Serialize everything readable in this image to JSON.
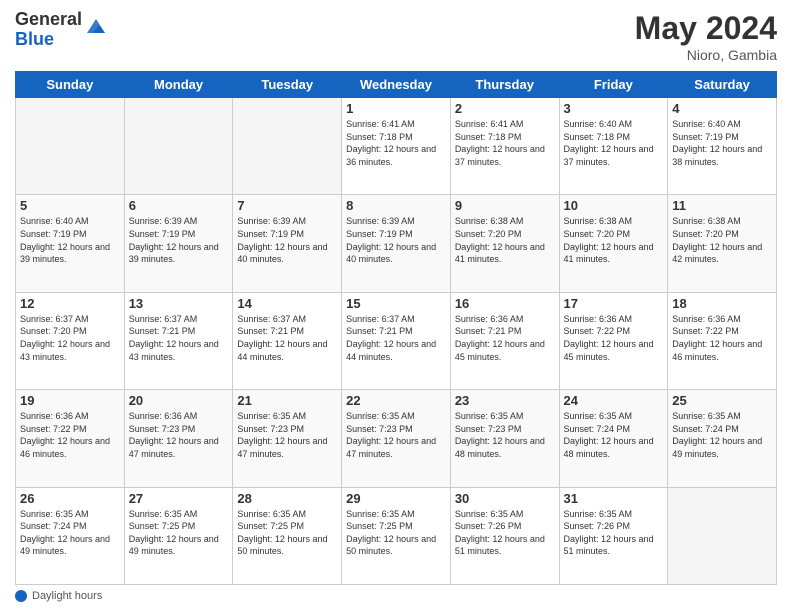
{
  "header": {
    "logo_general": "General",
    "logo_blue": "Blue",
    "month": "May 2024",
    "location": "Nioro, Gambia"
  },
  "weekdays": [
    "Sunday",
    "Monday",
    "Tuesday",
    "Wednesday",
    "Thursday",
    "Friday",
    "Saturday"
  ],
  "weeks": [
    [
      {
        "day": "",
        "info": ""
      },
      {
        "day": "",
        "info": ""
      },
      {
        "day": "",
        "info": ""
      },
      {
        "day": "1",
        "info": "Sunrise: 6:41 AM\nSunset: 7:18 PM\nDaylight: 12 hours and 36 minutes."
      },
      {
        "day": "2",
        "info": "Sunrise: 6:41 AM\nSunset: 7:18 PM\nDaylight: 12 hours and 37 minutes."
      },
      {
        "day": "3",
        "info": "Sunrise: 6:40 AM\nSunset: 7:18 PM\nDaylight: 12 hours and 37 minutes."
      },
      {
        "day": "4",
        "info": "Sunrise: 6:40 AM\nSunset: 7:19 PM\nDaylight: 12 hours and 38 minutes."
      }
    ],
    [
      {
        "day": "5",
        "info": "Sunrise: 6:40 AM\nSunset: 7:19 PM\nDaylight: 12 hours and 39 minutes."
      },
      {
        "day": "6",
        "info": "Sunrise: 6:39 AM\nSunset: 7:19 PM\nDaylight: 12 hours and 39 minutes."
      },
      {
        "day": "7",
        "info": "Sunrise: 6:39 AM\nSunset: 7:19 PM\nDaylight: 12 hours and 40 minutes."
      },
      {
        "day": "8",
        "info": "Sunrise: 6:39 AM\nSunset: 7:19 PM\nDaylight: 12 hours and 40 minutes."
      },
      {
        "day": "9",
        "info": "Sunrise: 6:38 AM\nSunset: 7:20 PM\nDaylight: 12 hours and 41 minutes."
      },
      {
        "day": "10",
        "info": "Sunrise: 6:38 AM\nSunset: 7:20 PM\nDaylight: 12 hours and 41 minutes."
      },
      {
        "day": "11",
        "info": "Sunrise: 6:38 AM\nSunset: 7:20 PM\nDaylight: 12 hours and 42 minutes."
      }
    ],
    [
      {
        "day": "12",
        "info": "Sunrise: 6:37 AM\nSunset: 7:20 PM\nDaylight: 12 hours and 43 minutes."
      },
      {
        "day": "13",
        "info": "Sunrise: 6:37 AM\nSunset: 7:21 PM\nDaylight: 12 hours and 43 minutes."
      },
      {
        "day": "14",
        "info": "Sunrise: 6:37 AM\nSunset: 7:21 PM\nDaylight: 12 hours and 44 minutes."
      },
      {
        "day": "15",
        "info": "Sunrise: 6:37 AM\nSunset: 7:21 PM\nDaylight: 12 hours and 44 minutes."
      },
      {
        "day": "16",
        "info": "Sunrise: 6:36 AM\nSunset: 7:21 PM\nDaylight: 12 hours and 45 minutes."
      },
      {
        "day": "17",
        "info": "Sunrise: 6:36 AM\nSunset: 7:22 PM\nDaylight: 12 hours and 45 minutes."
      },
      {
        "day": "18",
        "info": "Sunrise: 6:36 AM\nSunset: 7:22 PM\nDaylight: 12 hours and 46 minutes."
      }
    ],
    [
      {
        "day": "19",
        "info": "Sunrise: 6:36 AM\nSunset: 7:22 PM\nDaylight: 12 hours and 46 minutes."
      },
      {
        "day": "20",
        "info": "Sunrise: 6:36 AM\nSunset: 7:23 PM\nDaylight: 12 hours and 47 minutes."
      },
      {
        "day": "21",
        "info": "Sunrise: 6:35 AM\nSunset: 7:23 PM\nDaylight: 12 hours and 47 minutes."
      },
      {
        "day": "22",
        "info": "Sunrise: 6:35 AM\nSunset: 7:23 PM\nDaylight: 12 hours and 47 minutes."
      },
      {
        "day": "23",
        "info": "Sunrise: 6:35 AM\nSunset: 7:23 PM\nDaylight: 12 hours and 48 minutes."
      },
      {
        "day": "24",
        "info": "Sunrise: 6:35 AM\nSunset: 7:24 PM\nDaylight: 12 hours and 48 minutes."
      },
      {
        "day": "25",
        "info": "Sunrise: 6:35 AM\nSunset: 7:24 PM\nDaylight: 12 hours and 49 minutes."
      }
    ],
    [
      {
        "day": "26",
        "info": "Sunrise: 6:35 AM\nSunset: 7:24 PM\nDaylight: 12 hours and 49 minutes."
      },
      {
        "day": "27",
        "info": "Sunrise: 6:35 AM\nSunset: 7:25 PM\nDaylight: 12 hours and 49 minutes."
      },
      {
        "day": "28",
        "info": "Sunrise: 6:35 AM\nSunset: 7:25 PM\nDaylight: 12 hours and 50 minutes."
      },
      {
        "day": "29",
        "info": "Sunrise: 6:35 AM\nSunset: 7:25 PM\nDaylight: 12 hours and 50 minutes."
      },
      {
        "day": "30",
        "info": "Sunrise: 6:35 AM\nSunset: 7:26 PM\nDaylight: 12 hours and 51 minutes."
      },
      {
        "day": "31",
        "info": "Sunrise: 6:35 AM\nSunset: 7:26 PM\nDaylight: 12 hours and 51 minutes."
      },
      {
        "day": "",
        "info": ""
      }
    ]
  ],
  "footer": {
    "label": "Daylight hours"
  }
}
